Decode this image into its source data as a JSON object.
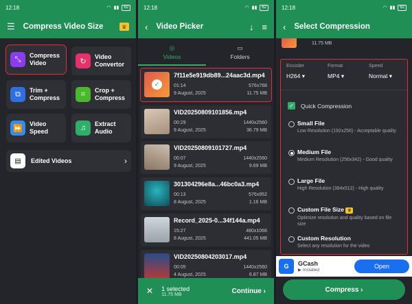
{
  "status": {
    "time": "12:18",
    "battery": "62"
  },
  "screen1": {
    "title": "Compress Video Size",
    "tiles": [
      {
        "label": "Compress\nVideo",
        "icon": "compress-icon",
        "color": "#8a3df0",
        "glyph": "⤡"
      },
      {
        "label": "Video\nConvertor",
        "icon": "convert-icon",
        "color": "#e8306a",
        "glyph": "↻"
      },
      {
        "label": "Trim +\nCompress",
        "icon": "trim-icon",
        "color": "#2f6fe6",
        "glyph": "⧉"
      },
      {
        "label": "Crop +\nCompress",
        "icon": "crop-icon",
        "color": "#49b82c",
        "glyph": "⌗"
      },
      {
        "label": "Video\nSpeed",
        "icon": "speed-icon",
        "color": "#2f8ef0",
        "glyph": "⏩"
      },
      {
        "label": "Extract\nAudio",
        "icon": "audio-icon",
        "color": "#2fae6a",
        "glyph": "♫"
      }
    ],
    "edited": "Edited Videos"
  },
  "screen2": {
    "title": "Video Picker",
    "tabs": [
      "Videos",
      "Folders"
    ],
    "videos": [
      {
        "name": "7f11e5e919db89...24aac3d.mp4",
        "duration": "01:14",
        "res": "576x768",
        "date": "9 August, 2025",
        "size": "11.75 MB"
      },
      {
        "name": "VID20250809101856.mp4",
        "duration": "00:29",
        "res": "1440x2560",
        "date": "9 August, 2025",
        "size": "36.79 MB"
      },
      {
        "name": "VID20250809101727.mp4",
        "duration": "00:07",
        "res": "1440x2560",
        "date": "9 August, 2025",
        "size": "9.69 MB"
      },
      {
        "name": "301304296e8a...46bc0a3.mp4",
        "duration": "00:13",
        "res": "576x952",
        "date": "8 August, 2025",
        "size": "1.16 MB"
      },
      {
        "name": "Record_2025-0...34f144a.mp4",
        "duration": "15:27",
        "res": "480x1066",
        "date": "8 August, 2025",
        "size": "441.05 MB"
      },
      {
        "name": "VID20250804203017.mp4",
        "duration": "00:05",
        "res": "1440x2560",
        "date": "4 August, 2025",
        "size": "6.87 MB"
      }
    ],
    "selected": "1 selected",
    "selected_size": "11.75 MB",
    "continue": "Continue"
  },
  "screen3": {
    "title": "Select Compression",
    "top_size": "11.75 MB",
    "encoder": {
      "label": "Encoder",
      "value": "H264"
    },
    "format": {
      "label": "Format",
      "value": "MP4"
    },
    "speed": {
      "label": "Speed",
      "value": "Normal"
    },
    "quick": "Quick Compression",
    "options": [
      {
        "title": "Small File",
        "desc": "Low Resolution (192x256) - Acceptable quality"
      },
      {
        "title": "Medium File",
        "desc": "Medium Resolution (256x342) - Good quality"
      },
      {
        "title": "Large File",
        "desc": "High Resolution (384x512) - High quality"
      },
      {
        "title": "Custom File Size",
        "desc": "Optimize resolution and quality based on file size"
      },
      {
        "title": "Custom Resolution",
        "desc": "Select any resolution for the video"
      }
    ],
    "ad": {
      "name": "GCash",
      "installed": "Installed",
      "open": "Open",
      "logo": "G"
    },
    "compress": "Compress"
  }
}
